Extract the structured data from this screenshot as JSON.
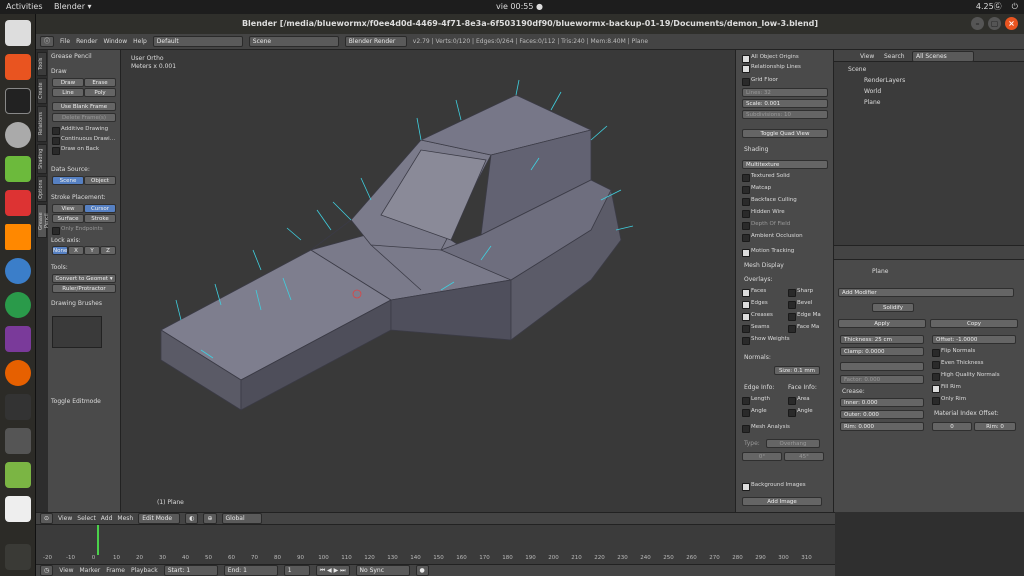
{
  "topbar": {
    "activities": "Activities",
    "app": "Blender ▾",
    "clock": "vie 00:55 ●",
    "battery": "4.25Ⓖ"
  },
  "window": {
    "title": "Blender [/media/bluewormx/f0ee4d0d-4469-4f71-8e3a-6f503190df90/bluewormx-backup-01-19/Documents/demon_low-3.blend]"
  },
  "info_header": {
    "menus": [
      "File",
      "Render",
      "Window",
      "Help"
    ],
    "layout": "Default",
    "scene": "Scene",
    "engine": "Blender Render",
    "stats": "v2.79 | Verts:0/120 | Edges:0/264 | Faces:0/112 | Tris:240 | Mem:8.40M | Plane"
  },
  "tool_tabs": [
    "Tools",
    "Create",
    "Relations",
    "Shading",
    "Options",
    "Grease Pencil"
  ],
  "tool_shelf": {
    "section": "Grease Pencil",
    "draw": "Draw",
    "draw_btns": [
      "Draw",
      "Erase",
      "Line",
      "Poly"
    ],
    "use_blank": "Use Blank Frame",
    "delete_frames": "Delete Frame(s)",
    "checks": [
      "Additive Drawing",
      "Continuous Drawi…",
      "Draw on Back"
    ],
    "data_source": "Data Source:",
    "source_btns": [
      "Scene",
      "Object"
    ],
    "stroke_placement": "Stroke Placement:",
    "placement_btns": [
      "View",
      "Cursor",
      "Surface",
      "Stroke"
    ],
    "only_endpoints": "Only Endpoints",
    "lock_axis": "Lock axis:",
    "axis_btns": [
      "None",
      "X",
      "Y",
      "Z"
    ],
    "tools": "Tools:",
    "convert": "Convert to Geomet ▾",
    "ruler": "Ruler/Protractor",
    "drawing_brushes": "Drawing Brushes",
    "toggle_editmode": "Toggle Editmode"
  },
  "viewport": {
    "view_label": "User Ortho",
    "meters": "Meters x 0.001",
    "object_label": "(1) Plane"
  },
  "properties_panel": {
    "checks_top": [
      "All Object Origins",
      "Relationship Lines"
    ],
    "grid_floor": "Grid Floor",
    "lines": "Lines:",
    "lines_val": "32",
    "scale": "Scale:",
    "scale_val": "0.001",
    "subdiv": "Subdivisions:",
    "subdiv_val": "10",
    "toggle_quad": "Toggle Quad View",
    "shading": "Shading",
    "multitexture": "Multitexture",
    "shading_checks": [
      "Textured Solid",
      "Matcap",
      "Backface Culling",
      "Hidden Wire",
      "Depth Of Field",
      "Ambient Occlusion"
    ],
    "motion_tracking": "Motion Tracking",
    "mesh_display": "Mesh Display",
    "overlays": "Overlays:",
    "overlay_left": [
      "Faces",
      "Edges",
      "Creases",
      "Seams",
      "Show Weights"
    ],
    "overlay_right": [
      "Sharp",
      "Bevel",
      "Edge Ma",
      "Face Ma"
    ],
    "normals": "Normals:",
    "normal_size": "Size: 0.1 mm",
    "edge_info": "Edge Info:",
    "face_info": "Face Info:",
    "edge_checks": [
      "Length",
      "Angle"
    ],
    "face_checks": [
      "Area",
      "Angle"
    ],
    "mesh_analysis": "Mesh Analysis",
    "type": "Type:",
    "type_val": "Overhang",
    "angles": [
      "0°",
      "45°"
    ],
    "bg_images": "Background Images",
    "add_image": "Add Image"
  },
  "outliner": {
    "view": "View",
    "search": "Search",
    "scenes": "All Scenes",
    "items": [
      "Scene",
      "RenderLayers",
      "World",
      "Plane"
    ]
  },
  "modifiers": {
    "obj": "Plane",
    "add_modifier": "Add Modifier",
    "name": "Solidify",
    "apply": "Apply",
    "copy": "Copy",
    "thickness": "Thickness:",
    "thickness_val": "25 cm",
    "offset": "Offset:",
    "offset_val": "-1.0000",
    "clamp": "Clamp:",
    "clamp_val": "0.0000",
    "factor": "Factor:",
    "factor_val": "0.000",
    "crease": "Crease:",
    "inner": "Inner:",
    "inner_val": "0.000",
    "outer": "Outer:",
    "outer_val": "0.000",
    "rim": "Rim:",
    "rim_val": "0.000",
    "checks": [
      "Flip Normals",
      "Even Thickness",
      "High Quality Normals",
      "Fill Rim",
      "Only Rim"
    ],
    "mat_offset": "Material Index Offset:",
    "mat_val": "0",
    "rim_mat": "Rim: 0"
  },
  "view_header": {
    "menus": [
      "View",
      "Select",
      "Add",
      "Mesh"
    ],
    "mode": "Edit Mode",
    "orientation": "Global"
  },
  "timeline": {
    "ticks": [
      "-20",
      "-10",
      "0",
      "10",
      "20",
      "30",
      "40",
      "50",
      "60",
      "70",
      "80",
      "90",
      "100",
      "110",
      "120",
      "130",
      "140",
      "150",
      "160",
      "170",
      "180",
      "190",
      "200",
      "210",
      "220",
      "230",
      "240",
      "250",
      "260",
      "270",
      "280",
      "290",
      "300",
      "310"
    ],
    "menus": [
      "View",
      "Marker",
      "Frame",
      "Playback"
    ],
    "start": "Start:",
    "start_val": "1",
    "end": "End:",
    "end_val": "1",
    "frame_val": "1",
    "sync": "No Sync"
  },
  "colors": {
    "accent_blue": "#5680c2",
    "ubuntu_orange": "#e95420",
    "mesh": "#6b6b7a",
    "normals": "#3fd0e0"
  }
}
